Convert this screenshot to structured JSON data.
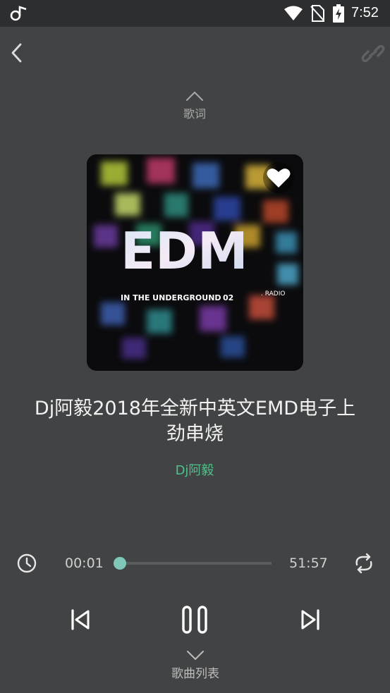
{
  "status_bar": {
    "time": "7:52"
  },
  "header": {
    "back_icon": "chevron-left-icon",
    "share_icon": "link-icon"
  },
  "lyrics_toggle": {
    "label": "歌词"
  },
  "cover": {
    "word": "EDM",
    "tagline": "IN THE UNDERGROUND",
    "tag_number": "02",
    "suffix": ". RADIO",
    "favorite_icon": "heart-icon"
  },
  "song": {
    "title": "Dj阿毅2018年全新中英文EMD电子上劲串烧",
    "artist": "Dj阿毅"
  },
  "player": {
    "current_time": "00:01",
    "total_time": "51:57",
    "progress": 0.0,
    "accent_color": "#7fc8b9",
    "artist_color": "#4fc28a"
  },
  "playlist_toggle": {
    "label": "歌曲列表"
  }
}
